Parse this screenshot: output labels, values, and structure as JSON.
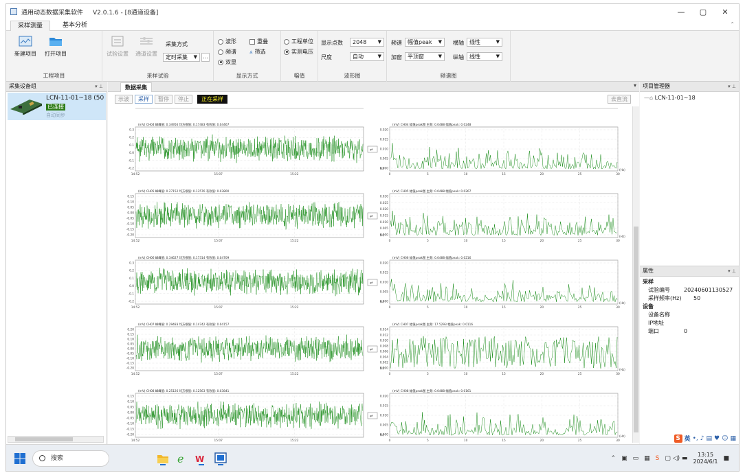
{
  "window": {
    "app_title": "通用动态数据采集软件",
    "version": "V2.0.1.6 - [8通道设备]",
    "min": "—",
    "max": "▢",
    "close": "✕"
  },
  "ribbon_tabs": [
    {
      "label": "采样测量"
    },
    {
      "label": "基本分析"
    }
  ],
  "ribbon": {
    "project": {
      "new": "新建项目",
      "open": "打开项目",
      "group": "工程项目"
    },
    "trial": {
      "settings": "试验设置",
      "channel": "通道设置",
      "mode_label": "采集方式",
      "mode_value": "定时采集",
      "more": "...",
      "group": "采样试验"
    },
    "display": {
      "waveform": "波形",
      "spectrum": "频谱",
      "dual": "双显",
      "overlay": "重叠",
      "filter": "筛选",
      "group": "显示方式"
    },
    "amplitude": {
      "eng": "工程单位",
      "volt": "实测电压",
      "group": "幅值"
    },
    "wave": {
      "points_label": "显示点数",
      "points_value": "2048",
      "scale_label": "尺度",
      "scale_value": "自动",
      "group": "波形图"
    },
    "spectrum": {
      "type_label": "频谱",
      "type_value": "幅值peak",
      "window_label": "加窗",
      "window_value": "平顶窗",
      "xaxis_label": "横轴",
      "xaxis_value": "线性",
      "yaxis_label": "纵轴",
      "yaxis_value": "线性",
      "group": "频谱图"
    }
  },
  "left_panel": {
    "title": "采集设备组",
    "device_name": "LCN-11-01~18 (50Hz)",
    "device_status": "已连接",
    "device_mode": "自动同步"
  },
  "center": {
    "tab": "数据采集",
    "buttons": [
      "示波",
      "采样",
      "暂停",
      "停止"
    ],
    "status": "正在采样",
    "clear": "去直流"
  },
  "right_panel": {
    "title": "项目管理器",
    "tree_item": "LCN-11-01~18",
    "props_title": "属性",
    "props": [
      {
        "cat": "采样"
      },
      {
        "k": "试验编号",
        "v": "20240601130527"
      },
      {
        "k": "采样频率(Hz)",
        "v": "50"
      },
      {
        "cat": "设备"
      },
      {
        "k": "设备名称",
        "v": ""
      },
      {
        "k": "IP地址",
        "v": ""
      },
      {
        "k": "端口",
        "v": "0"
      }
    ]
  },
  "taskbar": {
    "search": "搜索",
    "time": "13:15",
    "date": "2024/6/1",
    "ime": "英"
  },
  "colors": {
    "wave": "#1a8c1a",
    "accent": "#2b5fa8",
    "status_bg": "#101010",
    "status_fg": "#f6ee24"
  },
  "chart_data": [
    {
      "type": "line",
      "channel": "CH04",
      "title": "(mV) CH04 峰峰值: 0.34956 均方根值: 0.17483 有效值: 0.04467",
      "x_ticks": [
        "14:52",
        "15:07",
        "15:22"
      ],
      "y_ticks": [
        "0.3",
        "0.2",
        "0.1",
        "0.0",
        "-0.1",
        "-0.2"
      ],
      "ylim": [
        -0.25,
        0.3
      ]
    },
    {
      "type": "line",
      "channel": "CH04",
      "title": "(mV) CH04 幅值peak图 主频: 0.0488 幅值peak: 0.0248",
      "xlabel": "(Hz)",
      "x_ticks": [
        "0",
        "5",
        "10",
        "15",
        "20",
        "25",
        "30"
      ],
      "y_ticks": [
        "0.020",
        "0.015",
        "0.010",
        "0.005",
        "0.000"
      ],
      "ylim": [
        0,
        0.02
      ]
    },
    {
      "type": "line",
      "channel": "CH05",
      "title": "(mV) CH05 峰峰值: 0.27152 均方根值: 0.13576 有效值: 0.03800",
      "x_ticks": [
        "14:52",
        "15:07",
        "15:22"
      ],
      "y_ticks": [
        "0.15",
        "0.10",
        "0.05",
        "0.00",
        "-0.05",
        "-0.10",
        "-0.15",
        "-0.20"
      ],
      "ylim": [
        -0.2,
        0.15
      ]
    },
    {
      "type": "line",
      "channel": "CH05",
      "title": "(mV) CH05 幅值peak图 主频: 0.0488 幅值peak: 0.0267",
      "xlabel": "(Hz)",
      "x_ticks": [
        "0",
        "5",
        "10",
        "15",
        "20",
        "25",
        "30"
      ],
      "y_ticks": [
        "0.030",
        "0.025",
        "0.020",
        "0.015",
        "0.010",
        "0.005",
        "0.000"
      ],
      "ylim": [
        0,
        0.03
      ]
    },
    {
      "type": "line",
      "channel": "CH06",
      "title": "(mV) CH06 峰峰值: 0.34627 均方根值: 0.17314 有效值: 0.04709",
      "x_ticks": [
        "14:52",
        "15:07",
        "15:22"
      ],
      "y_ticks": [
        "0.3",
        "0.2",
        "0.1",
        "0.0",
        "-0.1",
        "-0.2"
      ],
      "ylim": [
        -0.25,
        0.3
      ]
    },
    {
      "type": "line",
      "channel": "CH06",
      "title": "(mV) CH06 幅值peak图 主频: 0.0488 幅值peak: 0.0216",
      "xlabel": "(Hz)",
      "x_ticks": [
        "0",
        "5",
        "10",
        "15",
        "20",
        "25",
        "30"
      ],
      "y_ticks": [
        "0.020",
        "0.015",
        "0.010",
        "0.005",
        "0.000"
      ],
      "ylim": [
        0,
        0.02
      ]
    },
    {
      "type": "line",
      "channel": "CH07",
      "title": "(mV) CH07 峰峰值: 0.29483 均方根值: 0.14742 有效值: 0.04157",
      "x_ticks": [
        "14:52",
        "15:07",
        "15:22"
      ],
      "y_ticks": [
        "0.20",
        "0.15",
        "0.10",
        "0.05",
        "0.00",
        "-0.05",
        "-0.10",
        "-0.15",
        "-0.20"
      ],
      "ylim": [
        -0.2,
        0.2
      ]
    },
    {
      "type": "line",
      "channel": "CH07",
      "title": "(mV) CH07 幅值peak图 主频: 17.5293 幅值peak: 0.0116",
      "xlabel": "(Hz)",
      "x_ticks": [
        "0",
        "5",
        "10",
        "15",
        "20",
        "25",
        "30"
      ],
      "y_ticks": [
        "0.014",
        "0.012",
        "0.010",
        "0.008",
        "0.006",
        "0.004",
        "0.002",
        "0.000"
      ],
      "ylim": [
        0,
        0.014
      ]
    },
    {
      "type": "line",
      "channel": "CH08",
      "title": "(mV) CH08 峰峰值: 0.25126 均方根值: 0.12563 有效值: 0.03841",
      "x_ticks": [
        "14:52",
        "15:07",
        "15:22"
      ],
      "y_ticks": [
        "0.15",
        "0.10",
        "0.05",
        "0.00",
        "-0.05",
        "-0.10",
        "-0.15",
        "-0.20"
      ],
      "ylim": [
        -0.2,
        0.15
      ]
    },
    {
      "type": "line",
      "channel": "CH08",
      "title": "(mV) CH08 幅值peak图 主频: 0.0488 幅值peak: 0.0161",
      "xlabel": "(Hz)",
      "x_ticks": [
        "0",
        "5",
        "10",
        "15",
        "20",
        "25",
        "30"
      ],
      "y_ticks": [
        "0.020",
        "0.015",
        "0.010",
        "0.005",
        "0.000"
      ],
      "ylim": [
        0,
        0.02
      ]
    }
  ]
}
